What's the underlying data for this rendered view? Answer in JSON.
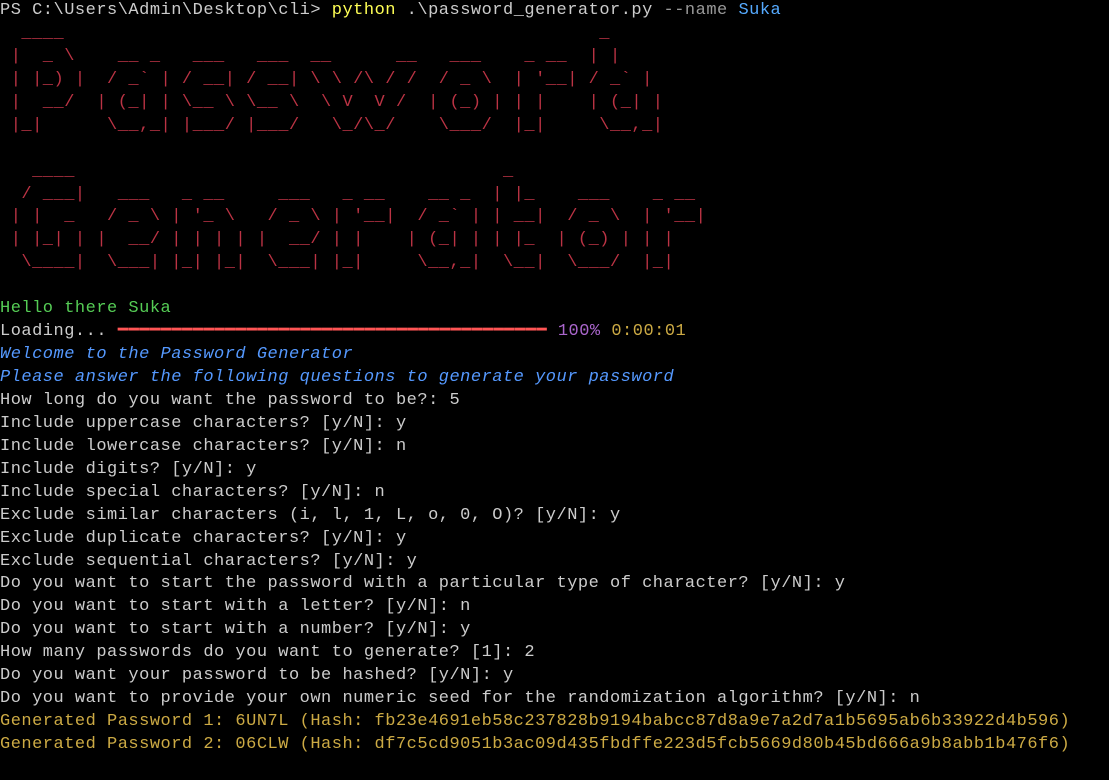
{
  "prompt": {
    "ps": "PS C:\\Users\\Admin\\Desktop\\cli> ",
    "python": "python",
    "script": " .\\password_generator.py ",
    "flag": "--name",
    "arg": " Suka"
  },
  "ascii_art": "  ____                                                  _\n |  _ \\    __ _   ___   ___  __      __   ___    _ __  | |\n | |_) |  / _` | / __| / __| \\ \\ /\\ / /  / _ \\  | '__| / _` |\n |  __/  | (_| | \\__ \\ \\__ \\  \\ V  V /  | (_) | | |    | (_| |\n |_|      \\__,_| |___/ |___/   \\_/\\_/    \\___/  |_|     \\__,_|\n\n   ____                                        _\n  / ___|   ___   _ __     ___   _ __    __ _  | |_    ___    _ __\n | |  _   / _ \\ | '_ \\   / _ \\ | '__|  / _` | | __|  / _ \\  | '__|\n | |_| | |  __/ | | | | |  __/ | |    | (_| | | |_  | (_) | | |\n  \\____|  \\___| |_| |_|  \\___| |_|     \\__,_|  \\__|  \\___/  |_|\n\n",
  "greeting": "Hello there Suka",
  "loading": {
    "label": "Loading... ",
    "bar": "━━━━━━━━━━━━━━━━━━━━━━━━━━━━━━━━━━━━━━━━",
    "pct": " 100%",
    "time": " 0:00:01"
  },
  "welcome": "Welcome to the Password Generator",
  "instructions": "Please answer the following questions to generate your password",
  "qa": [
    "How long do you want the password to be?: 5",
    "Include uppercase characters? [y/N]: y",
    "Include lowercase characters? [y/N]: n",
    "Include digits? [y/N]: y",
    "Include special characters? [y/N]: n",
    "Exclude similar characters (i, l, 1, L, o, 0, O)? [y/N]: y",
    "Exclude duplicate characters? [y/N]: y",
    "Exclude sequential characters? [y/N]: y",
    "Do you want to start the password with a particular type of character? [y/N]: y",
    "Do you want to start with a letter? [y/N]: n",
    "Do you want to start with a number? [y/N]: y",
    "How many passwords do you want to generate? [1]: 2",
    "Do you want your password to be hashed? [y/N]: y",
    "Do you want to provide your own numeric seed for the randomization algorithm? [y/N]: n"
  ],
  "results": [
    "Generated Password 1: 6UN7L (Hash: fb23e4691eb58c237828b9194babcc87d8a9e7a2d7a1b5695ab6b33922d4b596)",
    "Generated Password 2: 06CLW (Hash: df7c5cd9051b3ac09d435fbdffe223d5fcb5669d80b45bd666a9b8abb1b476f6)"
  ]
}
